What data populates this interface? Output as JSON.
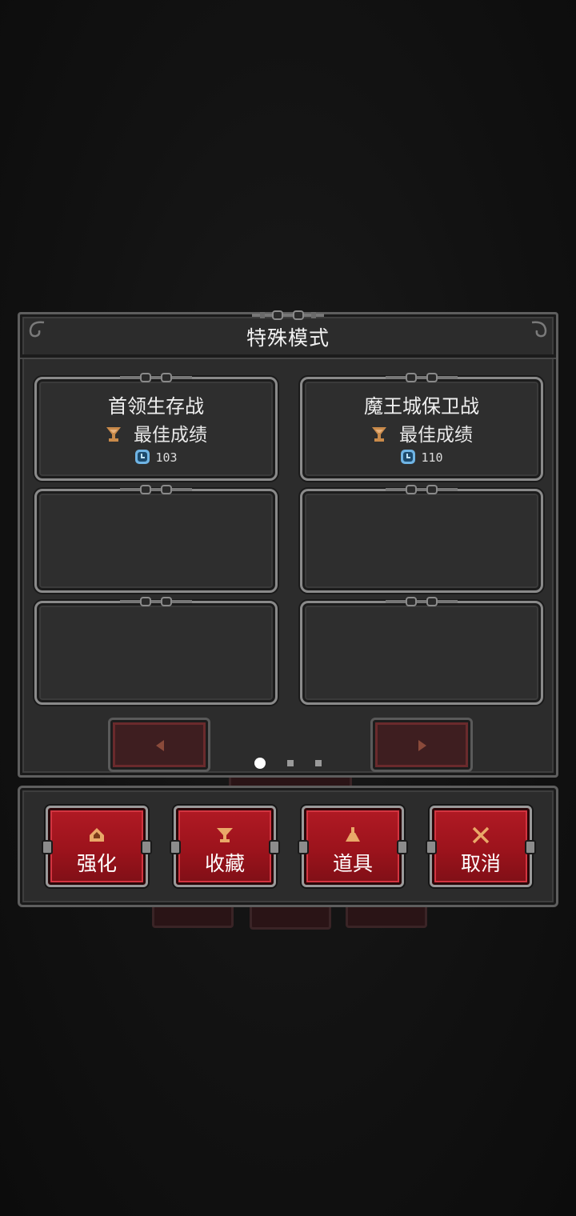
{
  "dialog": {
    "title": "特殊模式"
  },
  "modes": [
    {
      "title": "首领生存战",
      "best_label": "最佳成绩",
      "score": "103"
    },
    {
      "title": "魔王城保卫战",
      "best_label": "最佳成绩",
      "score": "110"
    },
    {
      "title": "",
      "best_label": "",
      "score": ""
    },
    {
      "title": "",
      "best_label": "",
      "score": ""
    },
    {
      "title": "",
      "best_label": "",
      "score": ""
    },
    {
      "title": "",
      "best_label": "",
      "score": ""
    }
  ],
  "pagination": {
    "current_page": 1,
    "total_pages": 3
  },
  "actions": [
    {
      "label": "强化",
      "icon": "upgrade-icon"
    },
    {
      "label": "收藏",
      "icon": "trophy-icon"
    },
    {
      "label": "道具",
      "icon": "potion-icon"
    },
    {
      "label": "取消",
      "icon": "close-icon"
    }
  ],
  "colors": {
    "accent_red": "#9c131c",
    "panel": "#2c2c2c",
    "trophy": "#c98a4a",
    "clock": "#6fb4e4"
  }
}
